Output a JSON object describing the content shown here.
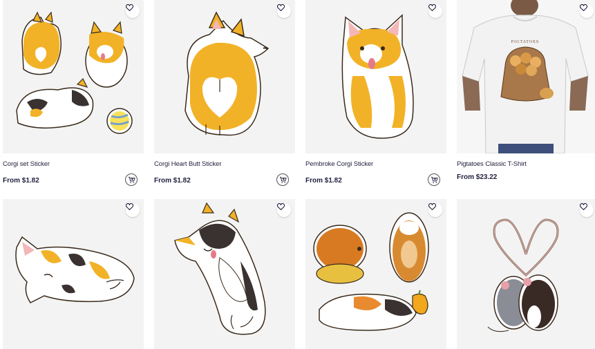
{
  "products": [
    {
      "title": "Corgi set Sticker",
      "price": "From $1.82",
      "icon": "corgi-set-sticker-image"
    },
    {
      "title": "Corgi Heart Butt Sticker",
      "price": "From $1.82",
      "icon": "corgi-heart-butt-sticker-image"
    },
    {
      "title": "Pembroke Corgi Sticker",
      "price": "From $1.82",
      "icon": "pembroke-corgi-sticker-image"
    },
    {
      "title": "Pigtatoes Classic T-Shirt",
      "price": "From $23.22",
      "icon": "pigtatoes-tshirt-image"
    },
    {
      "title": "",
      "price": "",
      "icon": "calico-cat-sticker-image"
    },
    {
      "title": "",
      "price": "",
      "icon": "tricolor-corgi-sticker-image"
    },
    {
      "title": "",
      "price": "",
      "icon": "guinea-pig-sticker-image"
    },
    {
      "title": "",
      "price": "",
      "icon": "rats-heart-sticker-image"
    }
  ],
  "shirt_print_text": "PIGTATOES",
  "colors": {
    "corgi": "#f2b227",
    "outline": "#3a2a1c",
    "bg": "#f3f3f3",
    "text": "#1f1f3d"
  }
}
